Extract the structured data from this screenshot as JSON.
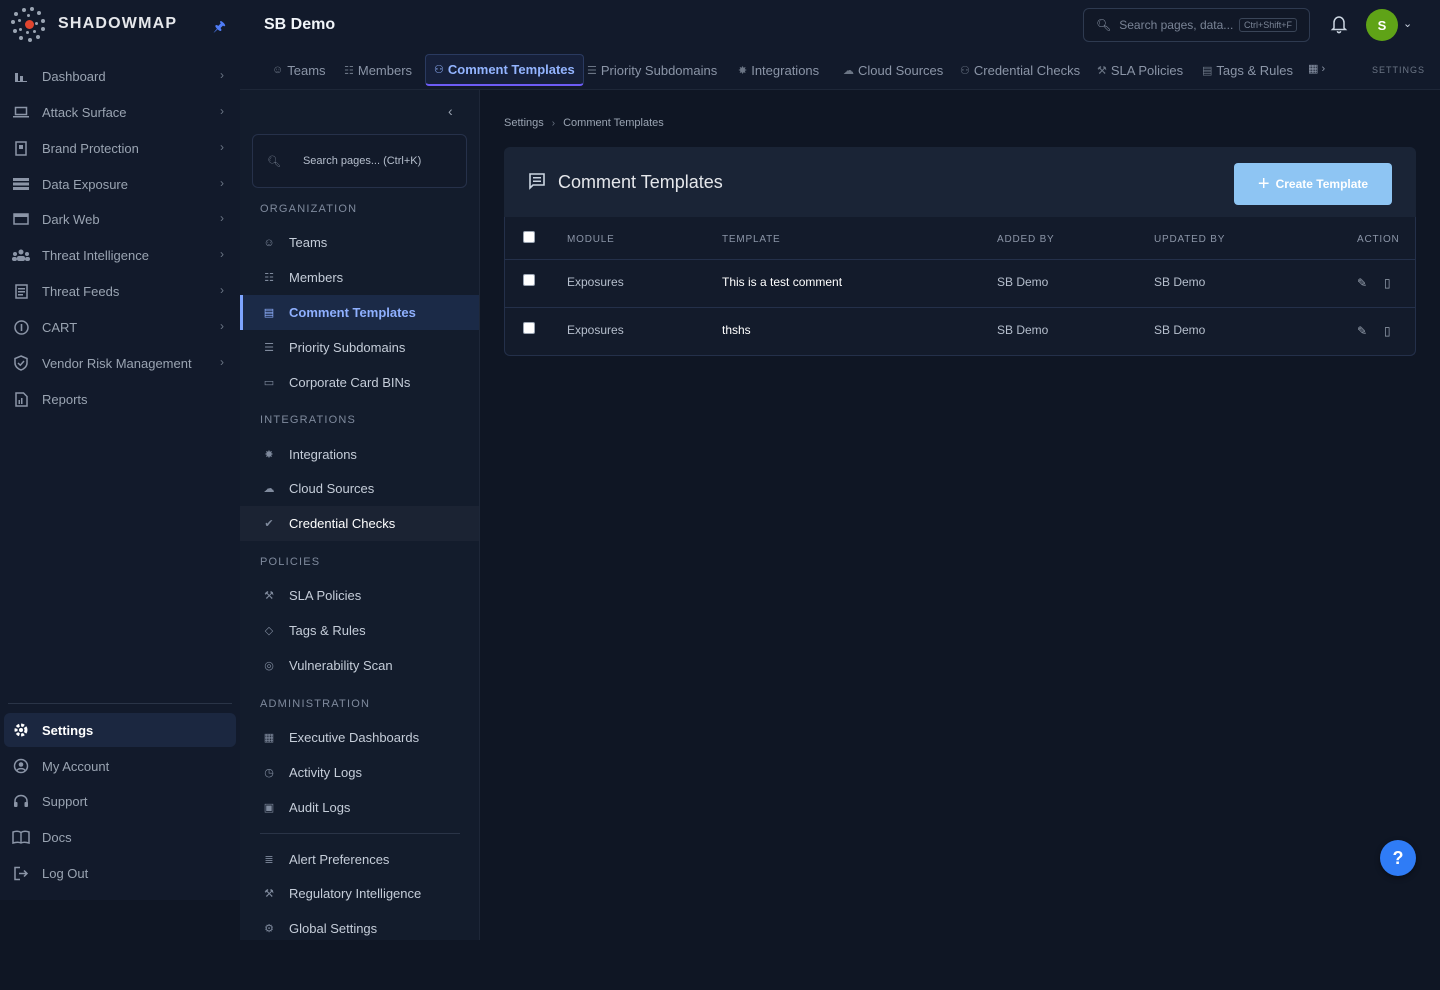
{
  "brand": {
    "name": "SHADOWMAP"
  },
  "sidebar": {
    "items": [
      {
        "label": "Dashboard",
        "icon": "bar-chart-icon"
      },
      {
        "label": "Attack Surface",
        "icon": "laptop-icon"
      },
      {
        "label": "Brand Protection",
        "icon": "badge-icon"
      },
      {
        "label": "Data Exposure",
        "icon": "database-icon"
      },
      {
        "label": "Dark Web",
        "icon": "monitor-icon"
      },
      {
        "label": "Threat Intelligence",
        "icon": "people-icon"
      },
      {
        "label": "Threat Feeds",
        "icon": "feed-icon"
      },
      {
        "label": "CART",
        "icon": "info-icon"
      },
      {
        "label": "Vendor Risk Management",
        "icon": "shield-check-icon"
      },
      {
        "label": "Reports",
        "icon": "report-icon"
      }
    ],
    "bottom_items": [
      {
        "label": "Settings",
        "icon": "gear-icon"
      },
      {
        "label": "My Account",
        "icon": "account-icon"
      },
      {
        "label": "Support",
        "icon": "headset-icon"
      },
      {
        "label": "Docs",
        "icon": "book-icon"
      },
      {
        "label": "Log Out",
        "icon": "logout-icon"
      }
    ]
  },
  "header": {
    "title": "SB Demo",
    "search_placeholder": "Search pages, data...",
    "search_shortcut": "Ctrl+Shift+F",
    "avatar_initial": "S",
    "avatar_color": "#5fa317"
  },
  "tabs": {
    "items": [
      {
        "label": "Teams",
        "icon": "teams-icon"
      },
      {
        "label": "Members",
        "icon": "members-icon"
      },
      {
        "label": "Comment Templates",
        "icon": "comment-icon"
      },
      {
        "label": "Priority Subdomains",
        "icon": "list-icon"
      },
      {
        "label": "Integrations",
        "icon": "puzzle-icon"
      },
      {
        "label": "Cloud Sources",
        "icon": "cloud-icon"
      },
      {
        "label": "Credential Checks",
        "icon": "key-icon"
      },
      {
        "label": "SLA Policies",
        "icon": "gavel-icon"
      },
      {
        "label": "Tags & Rules",
        "icon": "tag-icon"
      }
    ],
    "active_index": 2,
    "caption": "SETTINGS"
  },
  "sub_sidebar": {
    "search_placeholder": "Search pages... (Ctrl+K)",
    "sections": {
      "organization": "ORGANIZATION",
      "integrations": "INTEGRATIONS",
      "policies": "POLICIES",
      "administration": "ADMINISTRATION"
    },
    "items": {
      "teams": "Teams",
      "members": "Members",
      "comment_templates": "Comment Templates",
      "priority_subdomains": "Priority Subdomains",
      "corporate_card_bins": "Corporate Card BINs",
      "integrations": "Integrations",
      "cloud_sources": "Cloud Sources",
      "credential_checks": "Credential Checks",
      "sla_policies": "SLA Policies",
      "tags_rules": "Tags & Rules",
      "vulnerability_scan": "Vulnerability Scan",
      "executive_dashboards": "Executive Dashboards",
      "activity_logs": "Activity Logs",
      "audit_logs": "Audit Logs",
      "alert_preferences": "Alert Preferences",
      "regulatory_intelligence": "Regulatory Intelligence",
      "global_settings": "Global Settings"
    }
  },
  "breadcrumb": {
    "root": "Settings",
    "current": "Comment Templates"
  },
  "panel": {
    "title": "Comment Templates",
    "create_button": "Create Template",
    "create_button_color": "#8ec5f3"
  },
  "table": {
    "columns": {
      "module": "MODULE",
      "template": "TEMPLATE",
      "added_by": "ADDED BY",
      "updated_by": "UPDATED BY",
      "action": "ACTION"
    },
    "rows": [
      {
        "module": "Exposures",
        "template": "This is a test comment",
        "added_by": "SB Demo",
        "updated_by": "SB Demo"
      },
      {
        "module": "Exposures",
        "template": "thshs",
        "added_by": "SB Demo",
        "updated_by": "SB Demo"
      }
    ]
  },
  "help": {
    "label": "?"
  }
}
